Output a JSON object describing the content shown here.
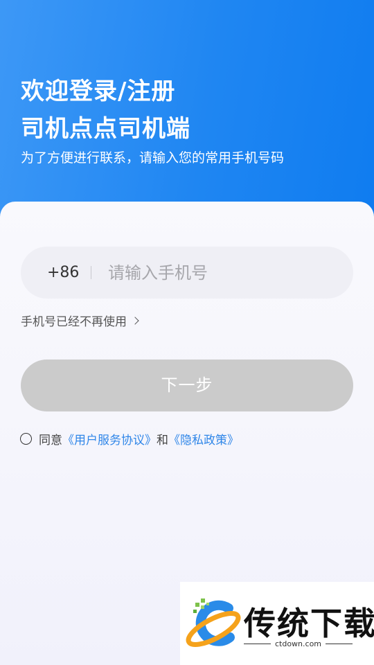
{
  "header": {
    "title_line1": "欢迎登录/注册",
    "title_line2": "司机点点司机端",
    "subtitle": "为了方便进行联系，请输入您的常用手机号码"
  },
  "form": {
    "country_code": "+86",
    "phone_placeholder": "请输入手机号",
    "phone_value": "",
    "phone_unused_link": "手机号已经不再使用",
    "next_button": "下一步",
    "agreement_prefix": "同意",
    "user_agreement_link": "《用户服务协议》",
    "agreement_and": "和",
    "privacy_link": "《隐私政策》"
  },
  "watermark": {
    "text": "传统下载",
    "domain": "ctdown.com"
  },
  "colors": {
    "header_gradient_start": "#3d98f6",
    "header_gradient_end": "#0f7cf0",
    "button_disabled": "#cbcbcb",
    "link": "#2f86e8"
  },
  "icons": {
    "chevron": "chevron-right-icon",
    "checkbox": "radio-circle-icon",
    "logo": "ctdown-logo-icon"
  }
}
